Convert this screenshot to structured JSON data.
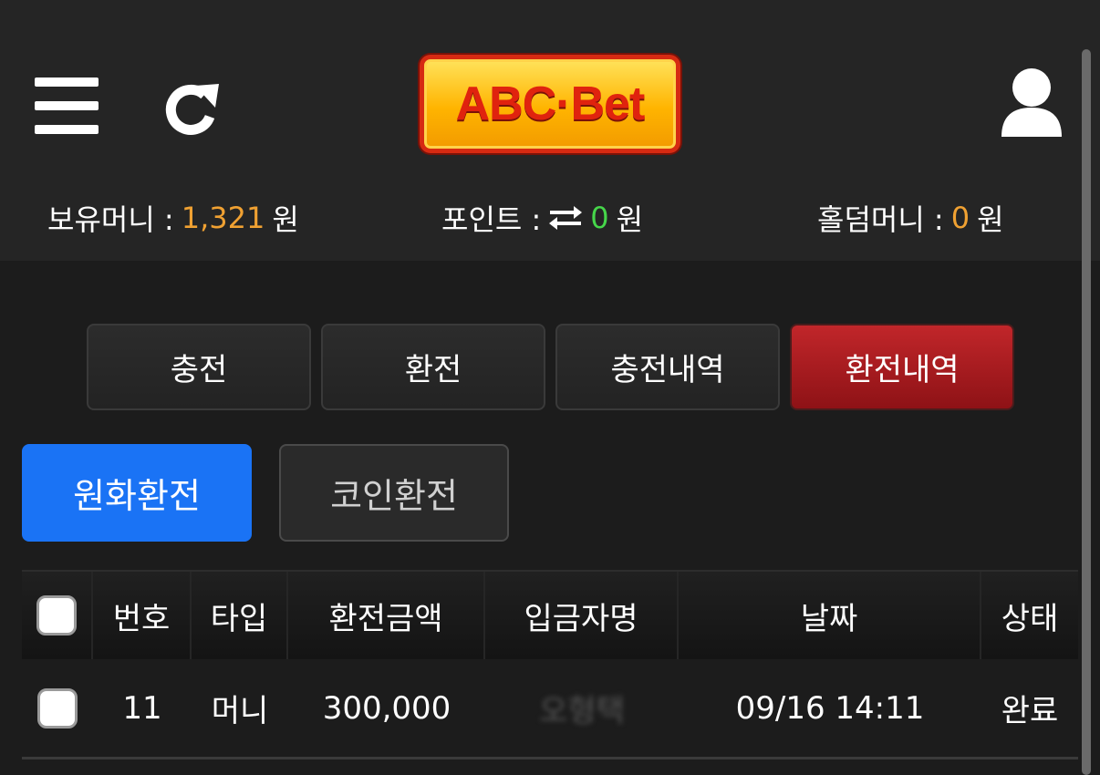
{
  "header": {
    "logo_text": "ABC·Bet",
    "menu_icon": "hamburger-menu-icon",
    "refresh_icon": "refresh-icon",
    "user_icon": "user-profile-icon"
  },
  "balances": {
    "money_label": "보유머니 :",
    "money_value": "1,321",
    "points_label": "포인트 :",
    "points_value": "0",
    "holding_label": "홀덤머니 :",
    "holding_value": "0",
    "unit": "원",
    "colors": {
      "money": "#f0a132",
      "points": "#46d64a",
      "holding": "#f0a132"
    }
  },
  "tabs": [
    {
      "label": "충전",
      "active": false
    },
    {
      "label": "환전",
      "active": false
    },
    {
      "label": "충전내역",
      "active": false
    },
    {
      "label": "환전내역",
      "active": true
    }
  ],
  "subtabs": [
    {
      "label": "원화환전",
      "active": true
    },
    {
      "label": "코인환전",
      "active": false
    }
  ],
  "table": {
    "headers": [
      "번호",
      "타입",
      "환전금액",
      "입금자명",
      "날짜",
      "상태"
    ],
    "rows": [
      {
        "number": "11",
        "type": "머니",
        "amount": "300,000",
        "depositor": "오형택",
        "date": "09/16 14:11",
        "status": "완료"
      }
    ]
  },
  "accent": {
    "active_tab": "#b11c20",
    "primary_button": "#1a73f5"
  }
}
